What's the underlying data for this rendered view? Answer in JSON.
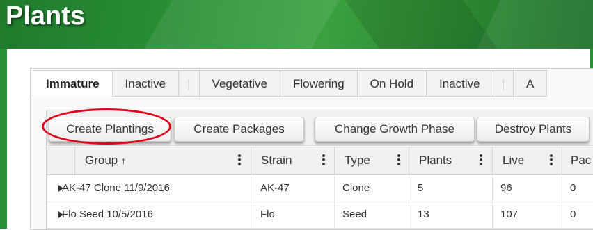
{
  "page": {
    "title": "Plants"
  },
  "tabs": [
    {
      "label": "Immature",
      "active": true
    },
    {
      "label": "Inactive"
    },
    {
      "label": "|",
      "separator": true
    },
    {
      "label": "Vegetative"
    },
    {
      "label": "Flowering"
    },
    {
      "label": "On Hold"
    },
    {
      "label": "Inactive"
    },
    {
      "label": "|",
      "separator": true
    },
    {
      "label": "A"
    }
  ],
  "toolbar": {
    "create_plantings": "Create Plantings",
    "create_packages": "Create Packages",
    "change_growth_phase": "Change Growth Phase",
    "destroy_plants": "Destroy Plants"
  },
  "grid": {
    "columns": [
      {
        "label": "Group",
        "sort_indicator": "↑"
      },
      {
        "label": "Strain"
      },
      {
        "label": "Type"
      },
      {
        "label": "Plants"
      },
      {
        "label": "Live"
      },
      {
        "label": "Pac"
      }
    ],
    "rows": [
      {
        "group": "AK-47 Clone 11/9/2016",
        "strain": "AK-47",
        "type": "Clone",
        "plants": "5",
        "live": "96",
        "pac": "0"
      },
      {
        "group": "Flo Seed 10/5/2016",
        "strain": "Flo",
        "type": "Seed",
        "plants": "13",
        "live": "107",
        "pac": "0"
      }
    ]
  },
  "colors": {
    "banner_green": "#2a8f36",
    "highlight_ellipse": "#e0001b"
  },
  "icons": {
    "expand": "caret-right-icon",
    "column_menu": "kebab-menu-icon",
    "sort": "sort-ascending-icon"
  }
}
